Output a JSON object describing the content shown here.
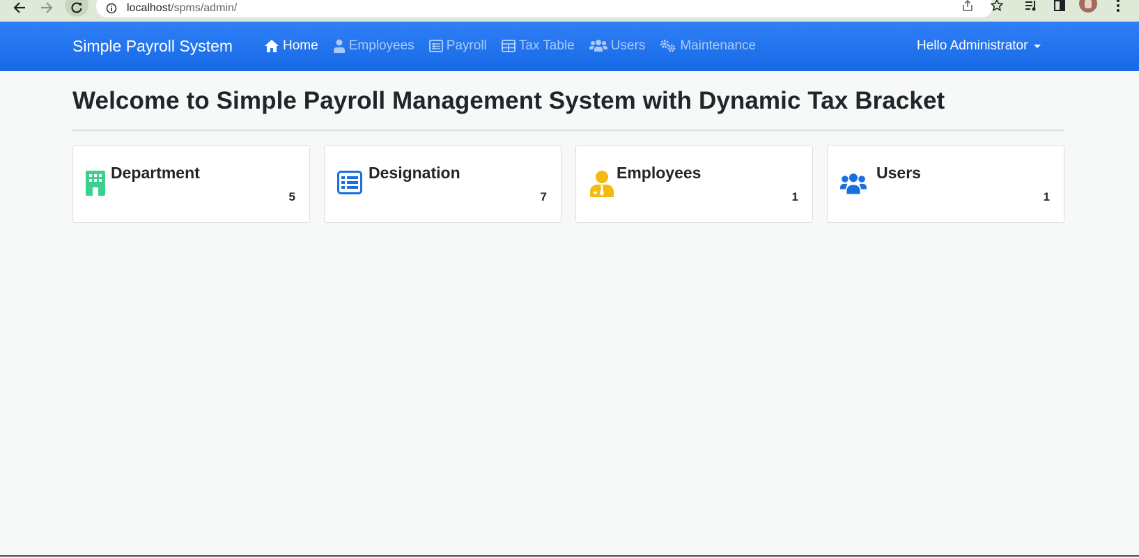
{
  "browser": {
    "url_host": "localhost",
    "url_path": "/spms/admin/"
  },
  "navbar": {
    "brand": "Simple Payroll System",
    "items": [
      {
        "label": "Home",
        "icon": "home-icon",
        "active": true
      },
      {
        "label": "Employees",
        "icon": "user-tie-icon",
        "active": false
      },
      {
        "label": "Payroll",
        "icon": "list-alt-icon",
        "active": false
      },
      {
        "label": "Tax Table",
        "icon": "table-icon",
        "active": false
      },
      {
        "label": "Users",
        "icon": "users-icon",
        "active": false
      },
      {
        "label": "Maintenance",
        "icon": "cogs-icon",
        "active": false
      }
    ],
    "user_greeting": "Hello Administrator"
  },
  "main": {
    "title": "Welcome to Simple Payroll Management System with Dynamic Tax Bracket",
    "cards": [
      {
        "label": "Department",
        "count": "5",
        "icon": "building-icon",
        "color": "#3ecf8e"
      },
      {
        "label": "Designation",
        "count": "7",
        "icon": "th-list-icon",
        "color": "#1a6fe0"
      },
      {
        "label": "Employees",
        "count": "1",
        "icon": "user-tie-icon",
        "color": "#f5b90f"
      },
      {
        "label": "Users",
        "count": "1",
        "icon": "users-icon",
        "color": "#1a6fe0"
      }
    ]
  },
  "colors": {
    "navbar": "#1f74ee",
    "page_bg": "#f7f8f8"
  }
}
